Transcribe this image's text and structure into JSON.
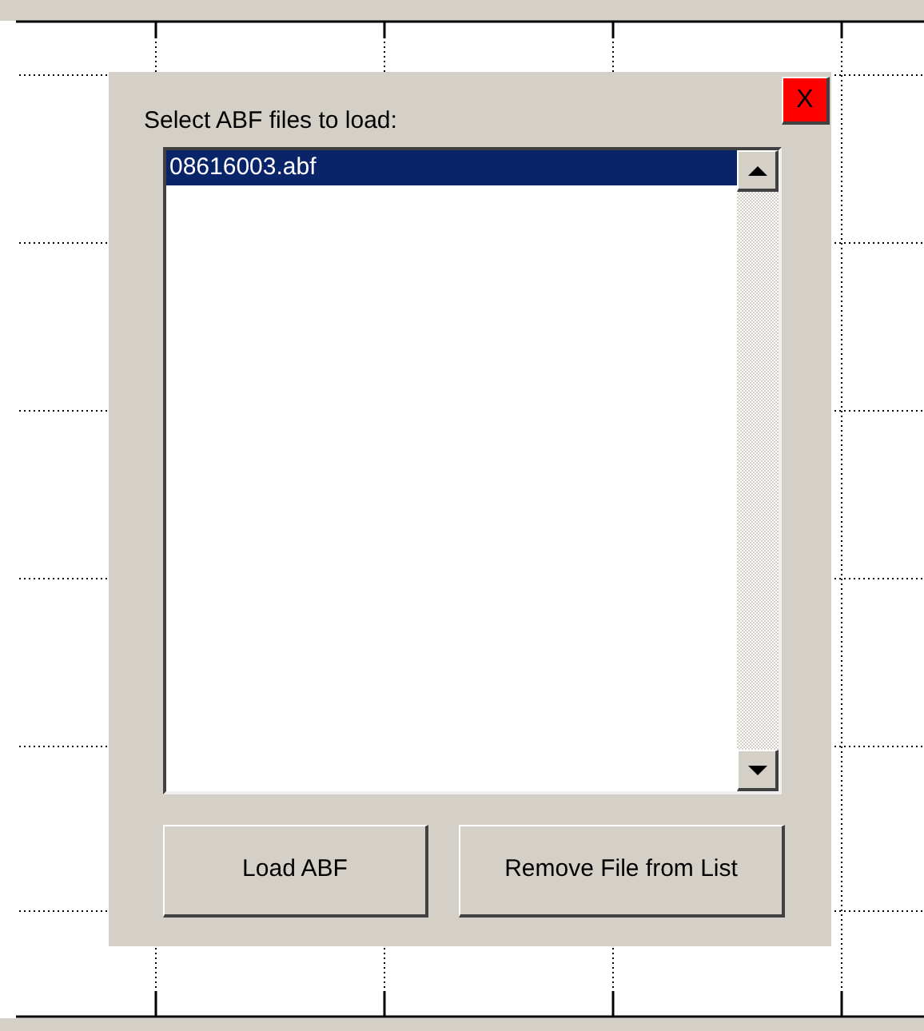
{
  "dialog": {
    "label": "Select ABF files to load:",
    "close_button": "X",
    "files": [
      {
        "name": "08616003.abf",
        "selected": true
      }
    ],
    "buttons": [
      "Load ABF",
      "Remove File from List"
    ]
  }
}
